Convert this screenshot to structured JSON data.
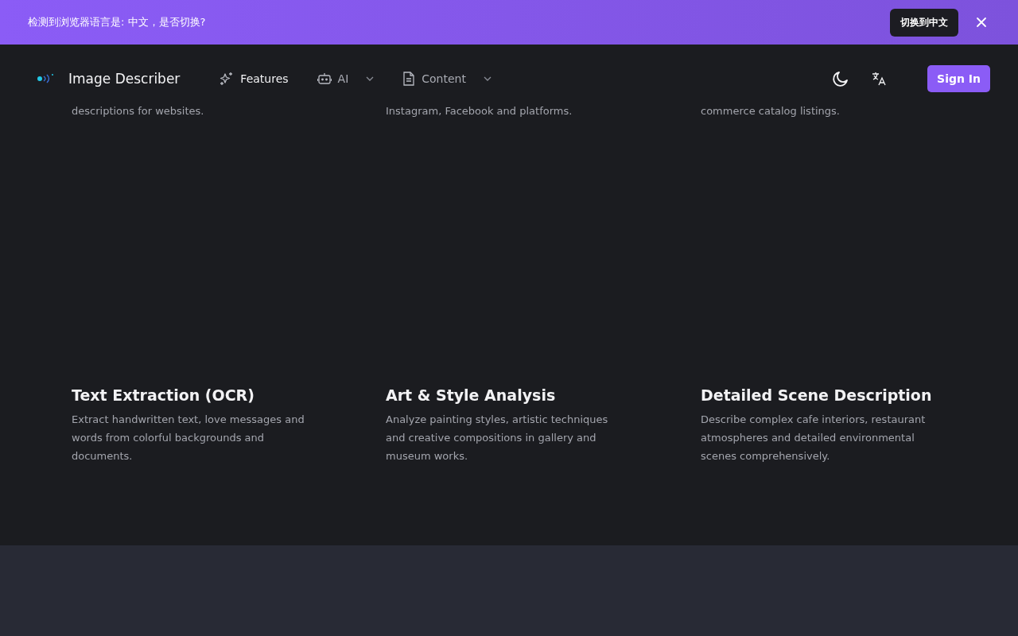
{
  "banner": {
    "message": "检测到浏览器语言是: 中文，是否切换?",
    "switch_button": "切换到中文"
  },
  "header": {
    "brand": "Image Describer",
    "nav": [
      {
        "label": "Features",
        "kind": "sparkles",
        "dropdown": false,
        "selected": true
      },
      {
        "label": "AI",
        "kind": "robot",
        "dropdown": true,
        "selected": false
      },
      {
        "label": "Content",
        "kind": "document",
        "dropdown": true,
        "selected": false
      }
    ],
    "sign_in": "Sign In"
  },
  "partial_cards": [
    "descriptions for websites.",
    "Instagram, Facebook and platforms.",
    "commerce catalog listings."
  ],
  "cards": [
    {
      "title": "Text Extraction (OCR)",
      "description": "Extract handwritten text, love messages and words from colorful backgrounds and documents."
    },
    {
      "title": "Art & Style Analysis",
      "description": "Analyze painting styles, artistic techniques and creative compositions in gallery and museum works."
    },
    {
      "title": "Detailed Scene Description",
      "description": "Describe complex cafe interiors, restaurant atmospheres and detailed environmental scenes comprehensively."
    }
  ]
}
